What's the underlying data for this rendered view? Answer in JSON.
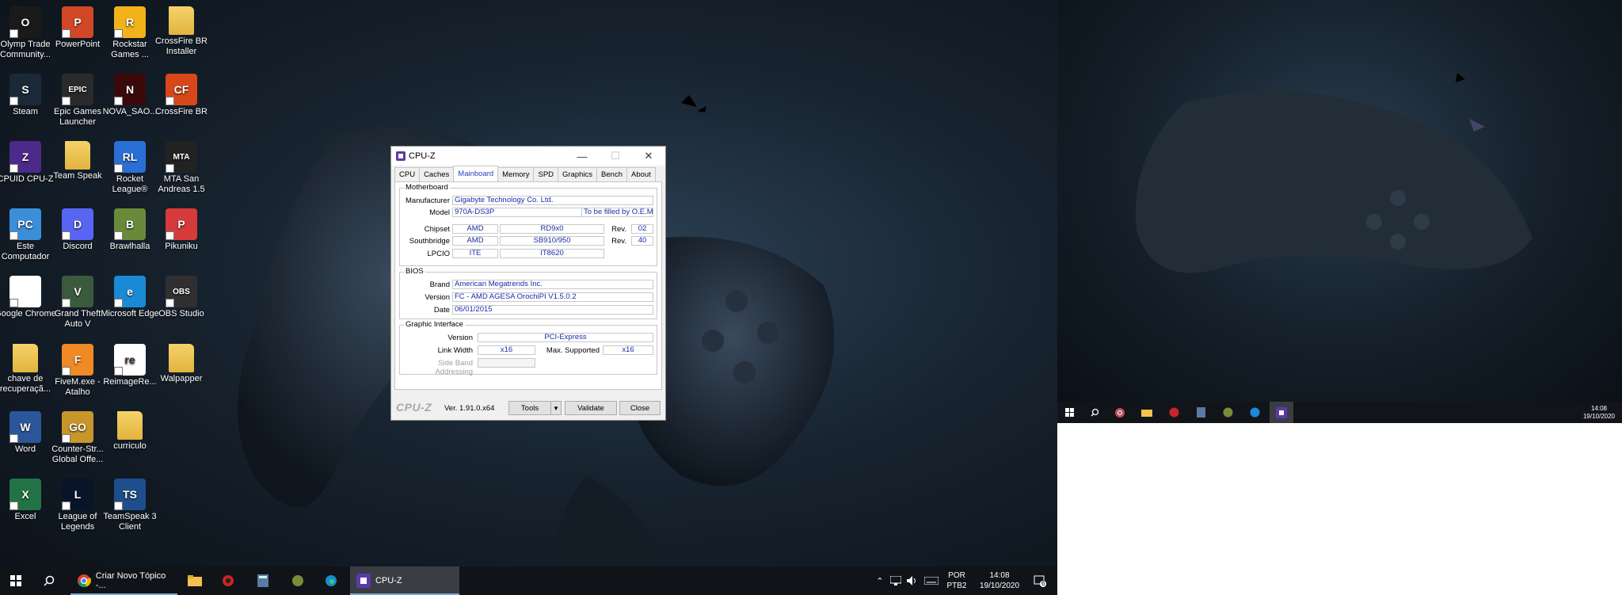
{
  "desktop_icons": [
    {
      "label": "Olymp Trade Community...",
      "color": "#1a1a1a",
      "glyph": "O",
      "icon": "olymp-trade-icon"
    },
    {
      "label": "PowerPoint",
      "color": "#d24726",
      "glyph": "P",
      "icon": "powerpoint-icon"
    },
    {
      "label": "Rockstar Games ...",
      "color": "#f3b21a",
      "glyph": "R",
      "icon": "rockstar-icon"
    },
    {
      "label": "CrossFire BR Installer",
      "color": "#e8c25a",
      "glyph": "",
      "icon": "folder-icon"
    },
    {
      "label": "Steam",
      "color": "#1b2838",
      "glyph": "S",
      "icon": "steam-icon"
    },
    {
      "label": "Epic Games Launcher",
      "color": "#2a2a2a",
      "glyph": "EPIC",
      "icon": "epic-games-icon"
    },
    {
      "label": "NOVA_SAO...",
      "color": "#3a0a0a",
      "glyph": "N",
      "icon": "nova-icon"
    },
    {
      "label": "CrossFire BR",
      "color": "#d8471a",
      "glyph": "CF",
      "icon": "crossfire-icon"
    },
    {
      "label": "CPUID CPU-Z",
      "color": "#4b2a8a",
      "glyph": "Z",
      "icon": "cpuz-icon"
    },
    {
      "label": "Team Speak",
      "color": "#e8c25a",
      "glyph": "",
      "icon": "folder-icon"
    },
    {
      "label": "Rocket League®",
      "color": "#2a6fd6",
      "glyph": "RL",
      "icon": "rocket-league-icon"
    },
    {
      "label": "MTA San Andreas 1.5",
      "color": "#222",
      "glyph": "MTA",
      "icon": "mta-icon"
    },
    {
      "label": "Este Computador",
      "color": "#3b8fd9",
      "glyph": "PC",
      "icon": "computer-icon"
    },
    {
      "label": "Discord",
      "color": "#5865f2",
      "glyph": "D",
      "icon": "discord-icon"
    },
    {
      "label": "Brawlhalla",
      "color": "#6a8a3a",
      "glyph": "B",
      "icon": "brawlhalla-icon"
    },
    {
      "label": "Pikuniku",
      "color": "#d63a3a",
      "glyph": "P",
      "icon": "pikuniku-icon"
    },
    {
      "label": "Google Chrome",
      "color": "#ffffff",
      "glyph": "",
      "icon": "chrome-icon"
    },
    {
      "label": "Grand Theft Auto V",
      "color": "#3b5a3b",
      "glyph": "V",
      "icon": "gta-icon"
    },
    {
      "label": "Microsoft Edge",
      "color": "#1a8ad4",
      "glyph": "e",
      "icon": "edge-icon"
    },
    {
      "label": "OBS Studio",
      "color": "#302e31",
      "glyph": "OBS",
      "icon": "obs-icon"
    },
    {
      "label": "chave de recuperaçã...",
      "color": "#e8c25a",
      "glyph": "",
      "icon": "folder-icon"
    },
    {
      "label": "FiveM.exe - Atalho",
      "color": "#f08a24",
      "glyph": "F",
      "icon": "fivem-icon"
    },
    {
      "label": "ReimageRe...",
      "color": "#ffffff",
      "glyph": "re",
      "icon": "reimage-icon"
    },
    {
      "label": "Walpapper",
      "color": "#e8c25a",
      "glyph": "",
      "icon": "folder-icon"
    },
    {
      "label": "Word",
      "color": "#2b579a",
      "glyph": "W",
      "icon": "word-icon"
    },
    {
      "label": "Counter-Str... Global Offe...",
      "color": "#c8962a",
      "glyph": "GO",
      "icon": "csgo-icon"
    },
    {
      "label": "curriculo",
      "color": "#e8c25a",
      "glyph": "",
      "icon": "folder-icon"
    },
    {
      "label": "",
      "color": "",
      "glyph": "",
      "icon": ""
    },
    {
      "label": "Excel",
      "color": "#217346",
      "glyph": "X",
      "icon": "excel-icon"
    },
    {
      "label": "League of Legends",
      "color": "#0a1428",
      "glyph": "L",
      "icon": "lol-icon"
    },
    {
      "label": "TeamSpeak 3 Client",
      "color": "#1d4f8c",
      "glyph": "TS",
      "icon": "teamspeak-icon"
    }
  ],
  "cpuz": {
    "title": "CPU-Z",
    "tabs": [
      "CPU",
      "Caches",
      "Mainboard",
      "Memory",
      "SPD",
      "Graphics",
      "Bench",
      "About"
    ],
    "active_tab": "Mainboard",
    "motherboard": {
      "group": "Motherboard",
      "manufacturer_label": "Manufacturer",
      "manufacturer": "Gigabyte Technology Co. Ltd.",
      "model_label": "Model",
      "model": "970A-DS3P",
      "model_extra": "To be filled by O.E.M.",
      "chipset_label": "Chipset",
      "chipset_vendor": "AMD",
      "chipset_name": "RD9x0",
      "rev_label": "Rev.",
      "chipset_rev": "02",
      "southbridge_label": "Southbridge",
      "sb_vendor": "AMD",
      "sb_name": "SB910/950",
      "sb_rev": "40",
      "lpcio_label": "LPCIO",
      "lpcio_vendor": "ITE",
      "lpcio_name": "IT8620"
    },
    "bios": {
      "group": "BIOS",
      "brand_label": "Brand",
      "brand": "American Megatrends Inc.",
      "version_label": "Version",
      "version": "FC - AMD AGESA OrochiPI V1.5.0.2",
      "date_label": "Date",
      "date": "06/01/2015"
    },
    "graphic": {
      "group": "Graphic Interface",
      "version_label": "Version",
      "version": "PCI-Express",
      "link_width_label": "Link Width",
      "link_width": "x16",
      "max_supported_label": "Max. Supported",
      "max_supported": "x16",
      "sba_label": "Side Band Addressing",
      "sba": ""
    },
    "footer": {
      "logo": "CPU-Z",
      "version": "Ver. 1.91.0.x64",
      "tools": "Tools",
      "validate": "Validate",
      "close": "Close"
    }
  },
  "taskbar1": {
    "chrome_label": "Criar Novo Tópico -...",
    "cpuz_label": "CPU-Z",
    "lang1": "POR",
    "lang2": "PTB2",
    "time": "14:08",
    "date": "19/10/2020",
    "notif_count": "6"
  },
  "taskbar2": {
    "time": "14:08",
    "date": "19/10/2020"
  }
}
